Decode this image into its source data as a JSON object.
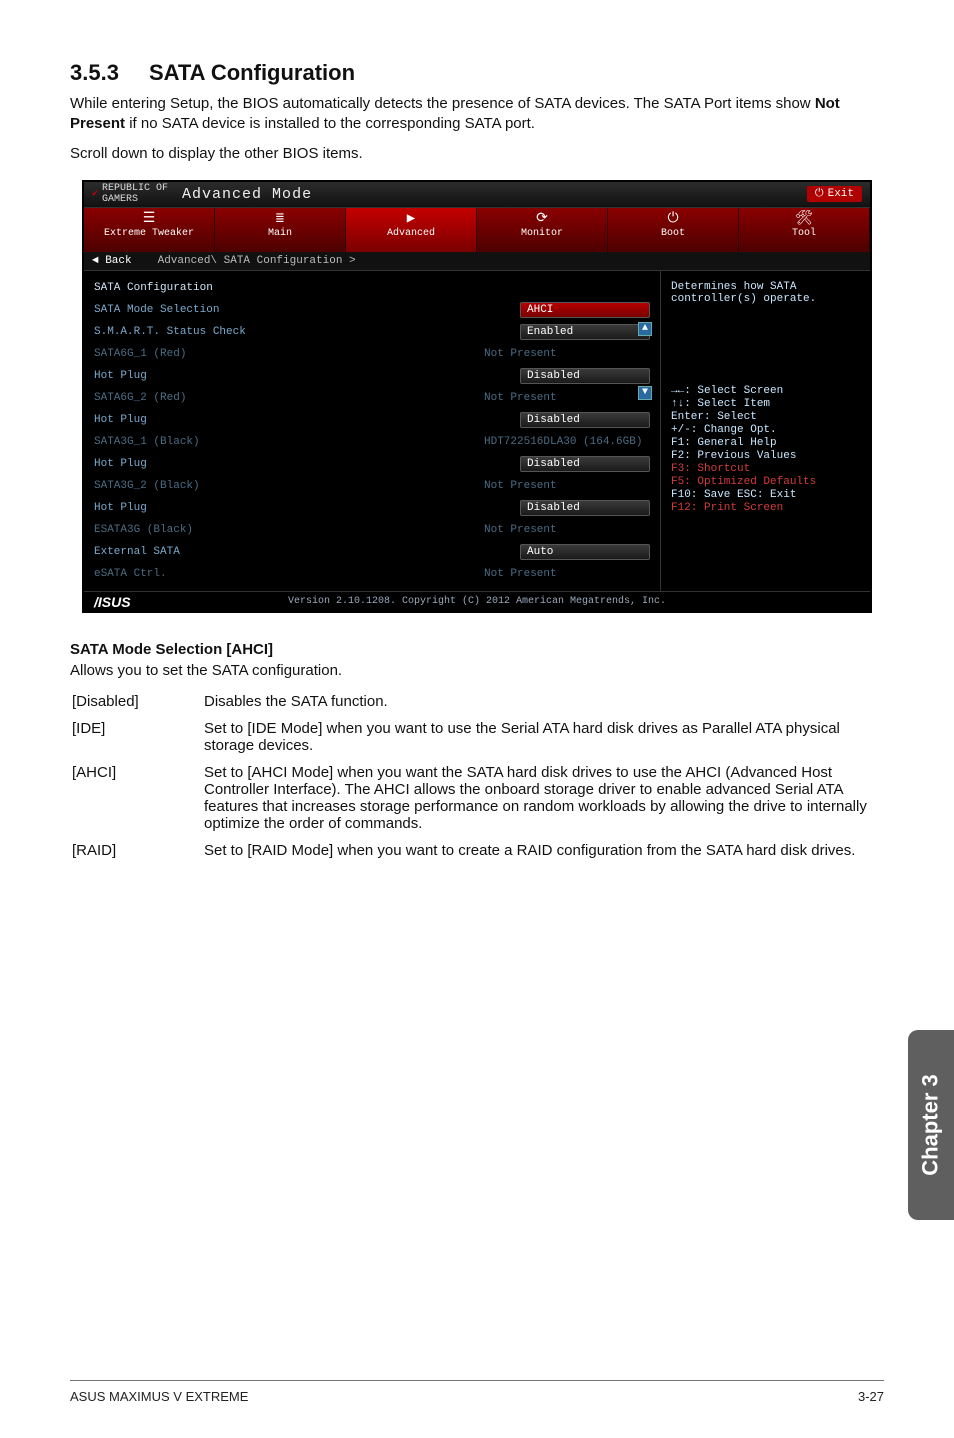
{
  "heading": {
    "number": "3.5.3",
    "title": "SATA Configuration"
  },
  "intro": "While entering Setup, the BIOS automatically detects the presence of SATA devices. The SATA Port items show Not Present if no SATA device is installed to the corresponding SATA port.",
  "intro_bold": "Not Present",
  "scroll_note": "Scroll down to display the other BIOS items.",
  "bios": {
    "logo_line1": "REPUBLIC OF",
    "logo_line2": "GAMERS",
    "mode_label": "Advanced Mode",
    "exit_label": "Exit",
    "tabs": [
      {
        "icon": "☰",
        "label": "Extreme Tweaker"
      },
      {
        "icon": "≣",
        "label": "Main"
      },
      {
        "icon": "▶",
        "label": "Advanced",
        "active": true
      },
      {
        "icon": "⟳",
        "label": "Monitor"
      },
      {
        "icon": "⏻",
        "label": "Boot"
      },
      {
        "icon": "🛠",
        "label": "Tool"
      }
    ],
    "back_label": "Back",
    "breadcrumb": "Advanced\\ SATA Configuration >",
    "left_rows": [
      {
        "label": "SATA Configuration",
        "value": "",
        "header": true
      },
      {
        "label": "SATA Mode Selection",
        "value": "AHCI",
        "pill": true,
        "highlight": true
      },
      {
        "label": "S.M.A.R.T. Status Check",
        "value": "Enabled",
        "pill": true
      },
      {
        "label": "SATA6G_1 (Red)",
        "value": "Not Present",
        "dim": true
      },
      {
        "label": " Hot Plug",
        "value": "Disabled",
        "pill": true
      },
      {
        "label": "SATA6G_2 (Red)",
        "value": "Not Present",
        "dim": true
      },
      {
        "label": " Hot Plug",
        "value": "Disabled",
        "pill": true
      },
      {
        "label": "SATA3G_1 (Black)",
        "value": "HDT722516DLA30 (164.6GB)",
        "dim": true
      },
      {
        "label": " Hot Plug",
        "value": "Disabled",
        "pill": true
      },
      {
        "label": "SATA3G_2 (Black)",
        "value": "Not Present",
        "dim": true
      },
      {
        "label": " Hot Plug",
        "value": "Disabled",
        "pill": true
      },
      {
        "label": "ESATA3G (Black)",
        "value": "Not Present",
        "dim": true
      },
      {
        "label": "External SATA",
        "value": "Auto",
        "pill": true
      },
      {
        "label": "eSATA Ctrl.",
        "value": "Not Present",
        "dim": true
      }
    ],
    "right_help_top": "Determines how SATA controller(s) operate.",
    "help_lines": [
      "→←: Select Screen",
      "↑↓: Select Item",
      "Enter: Select",
      "+/-: Change Opt.",
      "F1: General Help",
      "F2: Previous Values",
      "F3: Shortcut",
      "F5: Optimized Defaults",
      "F10: Save  ESC: Exit",
      "F12: Print Screen"
    ],
    "footer_brand": "/ISUS",
    "footer_text": "Version 2.10.1208. Copyright (C) 2012 American Megatrends, Inc."
  },
  "mode": {
    "heading": "SATA Mode Selection [AHCI]",
    "desc": "Allows you to set the SATA configuration.",
    "options": [
      {
        "key": "[Disabled]",
        "text": "Disables the SATA function."
      },
      {
        "key": "[IDE]",
        "text": "Set to [IDE Mode] when you want to use the Serial ATA hard disk drives as Parallel ATA physical storage devices."
      },
      {
        "key": "[AHCI]",
        "text": "Set to [AHCI Mode] when you want the SATA hard disk drives to use the AHCI (Advanced Host Controller Interface). The AHCI allows the onboard storage driver to enable advanced Serial ATA features that increases storage performance on random workloads by allowing the drive to internally optimize the order of commands."
      },
      {
        "key": "[RAID]",
        "text": "Set to [RAID Mode] when you want to create a RAID configuration from the SATA hard disk drives."
      }
    ]
  },
  "chapter_tab": "Chapter 3",
  "footer": {
    "left": "ASUS MAXIMUS V EXTREME",
    "right": "3-27"
  }
}
